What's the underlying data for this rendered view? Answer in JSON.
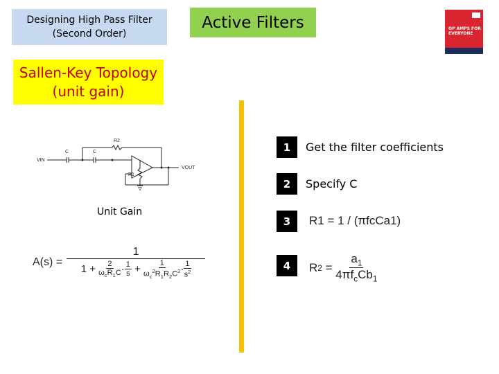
{
  "header": {
    "title_line1": "Designing High Pass Filter",
    "title_line2": "(Second Order)",
    "section": "Active Filters"
  },
  "book": {
    "title": "OP AMPS FOR EVERYONE"
  },
  "topology": {
    "line1": "Sallen-Key Topology",
    "line2": "(unit gain)"
  },
  "circuit": {
    "labels": {
      "vin": "VIN",
      "vout": "VOUT",
      "c1": "C",
      "c2": "C",
      "r1": "R1",
      "r2": "R2"
    },
    "caption": "Unit Gain"
  },
  "transfer": {
    "lhs": "A(s) =",
    "num": "1"
  },
  "steps": [
    {
      "num": "1",
      "text": "Get the filter coefficients"
    },
    {
      "num": "2",
      "text": "Specify C"
    },
    {
      "num": "3",
      "formula": "R1 = 1 / (πfcCa1)"
    },
    {
      "num": "4",
      "formula": "R2 = a1 / (4πfcCb1)"
    }
  ],
  "colors": {
    "title_bg": "#c6d9f1",
    "section_bg": "#92d050",
    "topology_bg": "#ffff00",
    "topology_text": "#c00000",
    "divider": "#f5c000"
  }
}
